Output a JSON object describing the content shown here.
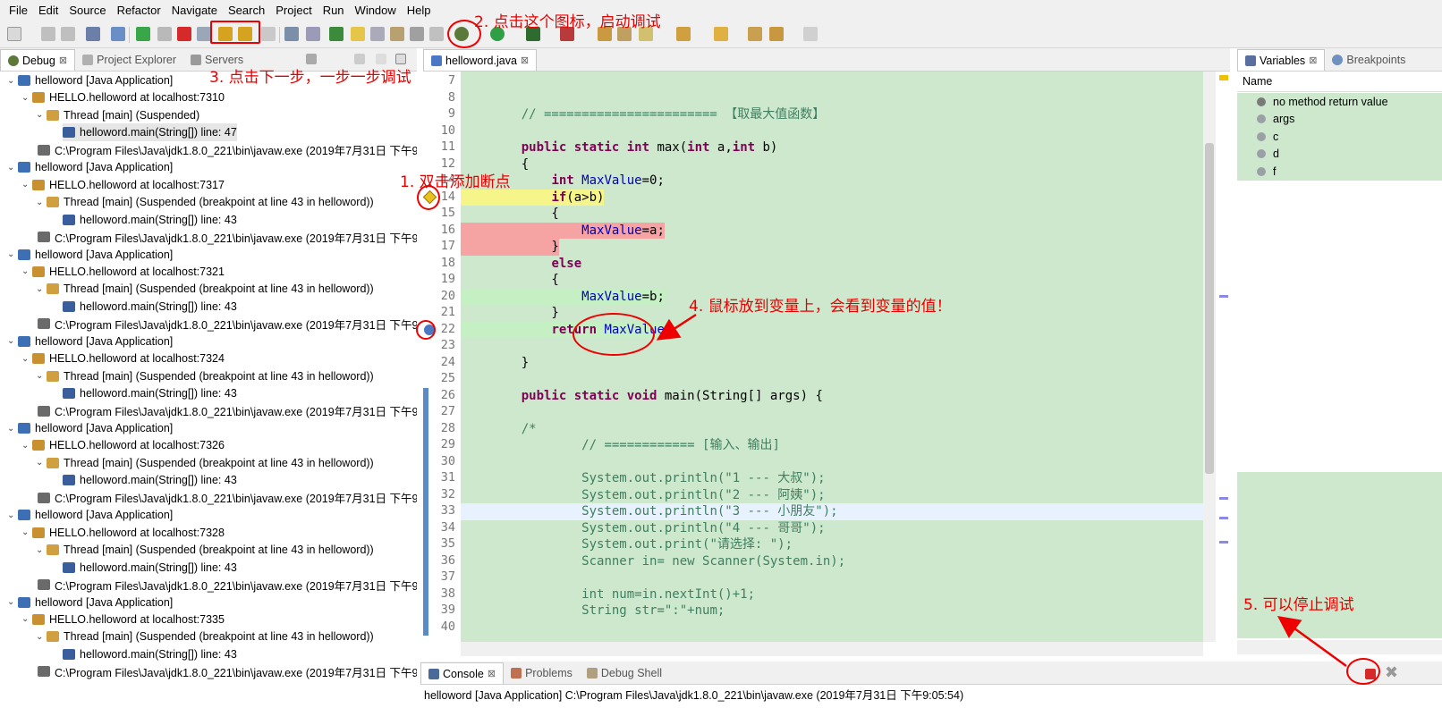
{
  "menu": [
    "File",
    "Edit",
    "Source",
    "Refactor",
    "Navigate",
    "Search",
    "Project",
    "Run",
    "Window",
    "Help"
  ],
  "debug_panel": {
    "tabs": [
      {
        "label": "Debug",
        "close": "⊠"
      },
      {
        "label": "Project Explorer"
      },
      {
        "label": "Servers"
      }
    ],
    "tree": [
      {
        "text": "helloword [Java Application]",
        "level": 0,
        "icon": "app-icon"
      },
      {
        "text": "HELLO.helloword at localhost:7310",
        "level": 1,
        "icon": "bug-icon"
      },
      {
        "text": "Thread [main] (Suspended)",
        "level": 2,
        "icon": "thread-icon"
      },
      {
        "text": "helloword.main(String[]) line: 47",
        "level": 3,
        "icon": "frame-icon",
        "selected": true
      },
      {
        "text": "C:\\Program Files\\Java\\jdk1.8.0_221\\bin\\javaw.exe (2019年7月31日 下午9:",
        "level": 1,
        "icon": "process-icon"
      },
      {
        "text": "helloword [Java Application]",
        "level": 0,
        "icon": "app-icon"
      },
      {
        "text": "HELLO.helloword at localhost:7317",
        "level": 1,
        "icon": "bug-icon"
      },
      {
        "text": "Thread [main] (Suspended (breakpoint at line 43 in helloword))",
        "level": 2,
        "icon": "thread-icon"
      },
      {
        "text": "helloword.main(String[]) line: 43",
        "level": 3,
        "icon": "frame-icon"
      },
      {
        "text": "C:\\Program Files\\Java\\jdk1.8.0_221\\bin\\javaw.exe (2019年7月31日 下午9:",
        "level": 1,
        "icon": "process-icon"
      },
      {
        "text": "helloword [Java Application]",
        "level": 0,
        "icon": "app-icon"
      },
      {
        "text": "HELLO.helloword at localhost:7321",
        "level": 1,
        "icon": "bug-icon"
      },
      {
        "text": "Thread [main] (Suspended (breakpoint at line 43 in helloword))",
        "level": 2,
        "icon": "thread-icon"
      },
      {
        "text": "helloword.main(String[]) line: 43",
        "level": 3,
        "icon": "frame-icon"
      },
      {
        "text": "C:\\Program Files\\Java\\jdk1.8.0_221\\bin\\javaw.exe (2019年7月31日 下午9:",
        "level": 1,
        "icon": "process-icon"
      },
      {
        "text": "helloword [Java Application]",
        "level": 0,
        "icon": "app-icon"
      },
      {
        "text": "HELLO.helloword at localhost:7324",
        "level": 1,
        "icon": "bug-icon"
      },
      {
        "text": "Thread [main] (Suspended (breakpoint at line 43 in helloword))",
        "level": 2,
        "icon": "thread-icon"
      },
      {
        "text": "helloword.main(String[]) line: 43",
        "level": 3,
        "icon": "frame-icon"
      },
      {
        "text": "C:\\Program Files\\Java\\jdk1.8.0_221\\bin\\javaw.exe (2019年7月31日 下午9:",
        "level": 1,
        "icon": "process-icon"
      },
      {
        "text": "helloword [Java Application]",
        "level": 0,
        "icon": "app-icon"
      },
      {
        "text": "HELLO.helloword at localhost:7326",
        "level": 1,
        "icon": "bug-icon"
      },
      {
        "text": "Thread [main] (Suspended (breakpoint at line 43 in helloword))",
        "level": 2,
        "icon": "thread-icon"
      },
      {
        "text": "helloword.main(String[]) line: 43",
        "level": 3,
        "icon": "frame-icon"
      },
      {
        "text": "C:\\Program Files\\Java\\jdk1.8.0_221\\bin\\javaw.exe (2019年7月31日 下午9:",
        "level": 1,
        "icon": "process-icon"
      },
      {
        "text": "helloword [Java Application]",
        "level": 0,
        "icon": "app-icon"
      },
      {
        "text": "HELLO.helloword at localhost:7328",
        "level": 1,
        "icon": "bug-icon"
      },
      {
        "text": "Thread [main] (Suspended (breakpoint at line 43 in helloword))",
        "level": 2,
        "icon": "thread-icon"
      },
      {
        "text": "helloword.main(String[]) line: 43",
        "level": 3,
        "icon": "frame-icon"
      },
      {
        "text": "C:\\Program Files\\Java\\jdk1.8.0_221\\bin\\javaw.exe (2019年7月31日 下午9:",
        "level": 1,
        "icon": "process-icon"
      },
      {
        "text": "helloword [Java Application]",
        "level": 0,
        "icon": "app-icon"
      },
      {
        "text": "HELLO.helloword at localhost:7335",
        "level": 1,
        "icon": "bug-icon"
      },
      {
        "text": "Thread [main] (Suspended (breakpoint at line 43 in helloword))",
        "level": 2,
        "icon": "thread-icon"
      },
      {
        "text": "helloword.main(String[]) line: 43",
        "level": 3,
        "icon": "frame-icon"
      },
      {
        "text": "C:\\Program Files\\Java\\jdk1.8.0_221\\bin\\javaw.exe (2019年7月31日 下午9:",
        "level": 1,
        "icon": "process-icon"
      }
    ]
  },
  "editor": {
    "tab": "helloword.java",
    "lines": [
      {
        "n": "7",
        "html": ""
      },
      {
        "n": "8",
        "html": ""
      },
      {
        "n": "9",
        "html": "    <span class=\"cm\">// ======================= 【取最大值函数】</span>"
      },
      {
        "n": "10",
        "html": ""
      },
      {
        "n": "11",
        "html": "    <span class=\"kw\">public static int</span> max(<span class=\"kw\">int</span> a,<span class=\"kw\">int</span> b)"
      },
      {
        "n": "12",
        "html": "    {"
      },
      {
        "n": "14",
        "html": "        <span class=\"kw\">int</span> <span class=\"var\">MaxValue</span>=0;"
      },
      {
        "n": "14",
        "html": "        <span class=\"kw\">if</span>(a>b)",
        "bg": "#f5f58a"
      },
      {
        "n": "15",
        "html": "        {"
      },
      {
        "n": "16",
        "html": "            <span class=\"var\">MaxValue</span>=a;",
        "bg": "#f5a3a3"
      },
      {
        "n": "17",
        "html": "        }",
        "bg": "#f5a3a3"
      },
      {
        "n": "18",
        "html": "        <span class=\"kw\">else</span>"
      },
      {
        "n": "19",
        "html": "        {"
      },
      {
        "n": "20",
        "html": "            <span class=\"var\">MaxValue</span>=b;",
        "bg": "#c4f0c4"
      },
      {
        "n": "21",
        "html": "        }"
      },
      {
        "n": "22",
        "html": "        <span class=\"kw\">return</span> <span class=\"var\">MaxValue</span>;",
        "bg": "#c4f0c4"
      },
      {
        "n": "23",
        "html": ""
      },
      {
        "n": "24",
        "html": "    }"
      },
      {
        "n": "25",
        "html": ""
      },
      {
        "n": "26",
        "html": "    <span class=\"kw\">public static void</span> main(String[] args) {"
      },
      {
        "n": "27",
        "html": ""
      },
      {
        "n": "28",
        "html": "    <span class=\"cm\">/*</span>"
      },
      {
        "n": "29",
        "html": "            <span class=\"cm\">// ============ [输入、输出]</span>"
      },
      {
        "n": "30",
        "html": ""
      },
      {
        "n": "31",
        "html": "            <span class=\"cm\">System.out.println(\"1 --- 大叔\");</span>"
      },
      {
        "n": "32",
        "html": "            <span class=\"cm\">System.out.println(\"2 --- 阿姨\");</span>"
      },
      {
        "n": "33",
        "html": "            <span class=\"cm\">System.out.println(\"3 --- 小朋友\");</span>",
        "bg": "#e8f2fe"
      },
      {
        "n": "34",
        "html": "            <span class=\"cm\">System.out.println(\"4 --- 哥哥\");</span>"
      },
      {
        "n": "35",
        "html": "            <span class=\"cm\">System.out.print(\"请选择: \");</span>"
      },
      {
        "n": "36",
        "html": "            <span class=\"cm\">Scanner in= new Scanner(System.in);</span>"
      },
      {
        "n": "37",
        "html": ""
      },
      {
        "n": "38",
        "html": "            <span class=\"cm\">int num=in.nextInt()+1;</span>"
      },
      {
        "n": "39",
        "html": "            <span class=\"cm\">String str=\":\"+num;</span>"
      },
      {
        "n": "40",
        "html": ""
      }
    ]
  },
  "variables": {
    "tabs": [
      "Variables",
      "Breakpoints"
    ],
    "header": "Name",
    "rows": [
      "no method return value",
      "args",
      "c",
      "d",
      "f"
    ]
  },
  "console": {
    "tabs": [
      "Console",
      "Problems",
      "Debug Shell"
    ],
    "text": "helloword [Java Application] C:\\Program Files\\Java\\jdk1.8.0_221\\bin\\javaw.exe (2019年7月31日 下午9:05:54)"
  },
  "annotations": {
    "a1": "1. 双击添加断点",
    "a2": "2. 点击这个图标，启动调试",
    "a3": "3. 点击下一步，一步一步调试",
    "a4": "4. 鼠标放到变量上，会看到变量的值！",
    "a5": "5. 可以停止调试"
  }
}
